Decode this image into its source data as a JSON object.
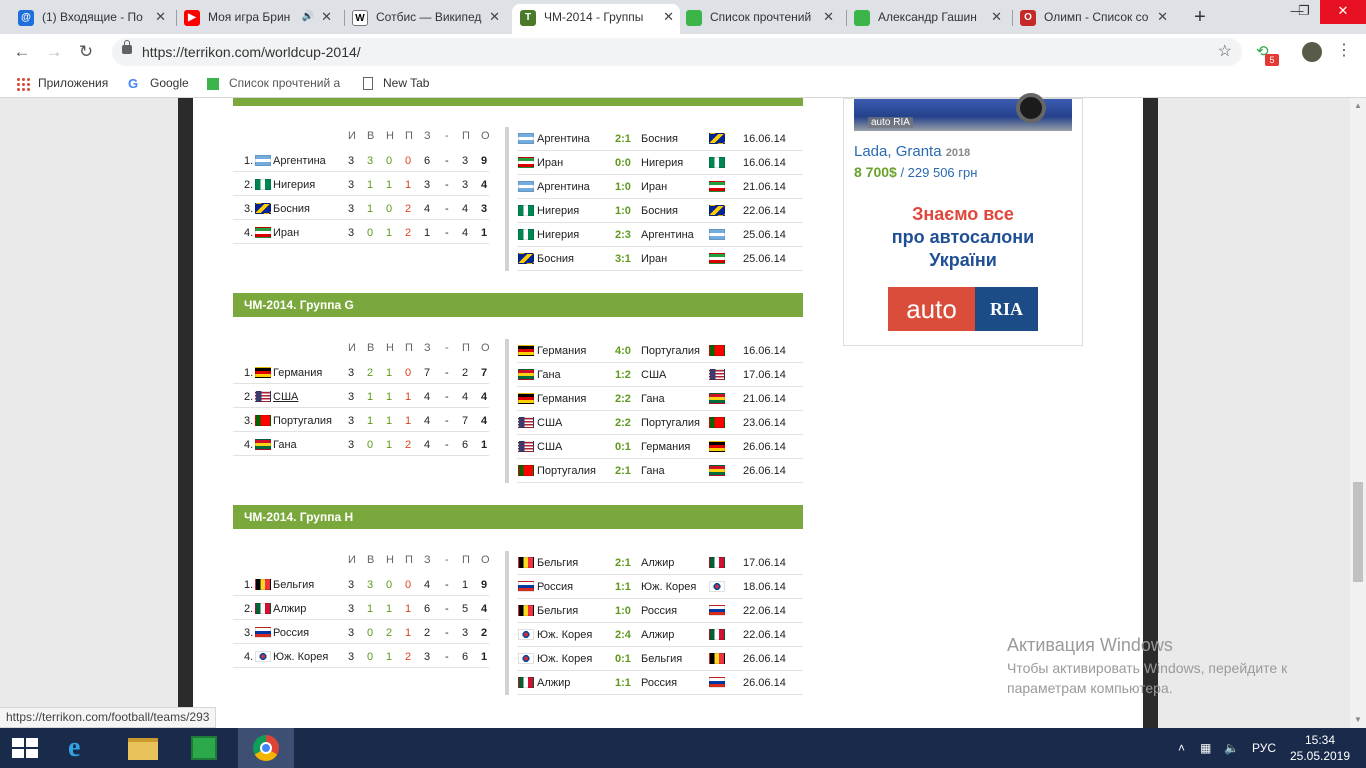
{
  "browser": {
    "tabs": [
      {
        "title": "(1) Входящие - По",
        "icon": "mail-icon",
        "color": "#1e6fd9",
        "glyph": "@"
      },
      {
        "title": "Моя игра Брин",
        "icon": "youtube-icon",
        "color": "#ff0000",
        "glyph": "▶",
        "audio": "🔊"
      },
      {
        "title": "Сотбис — Википед",
        "icon": "wikipedia-icon",
        "color": "#ffffff",
        "glyph": "W"
      },
      {
        "title": "ЧМ-2014 - Группы",
        "icon": "terrikon-icon",
        "color": "#4a7a2a",
        "glyph": "T"
      },
      {
        "title": "Список прочтений",
        "icon": "sheet-icon",
        "color": "#3bb54a",
        "glyph": ""
      },
      {
        "title": "Александр Гашин",
        "icon": "sheet-icon",
        "color": "#3bb54a",
        "glyph": ""
      },
      {
        "title": "Олимп - Список со",
        "icon": "olimp-icon",
        "color": "#c62828",
        "glyph": "O"
      }
    ],
    "new_tab": "+",
    "url": "https://terrikon.com/worldcup-2014/",
    "extension_badge": "5",
    "bookmarks": [
      {
        "label": "Приложения",
        "icon": "apps-grid-icon"
      },
      {
        "label": "Google",
        "icon": "google-icon"
      },
      {
        "label": "Список прочтений а",
        "icon": "sheet-icon"
      },
      {
        "label": "New Tab",
        "icon": "page-icon"
      }
    ],
    "status_link": "https://terrikon.com/football/teams/293"
  },
  "flags": {
    "argentina": [
      "#74acdf",
      "#ffffff",
      "#74acdf",
      "h"
    ],
    "nigeria": [
      "#008751",
      "#ffffff",
      "#008751",
      "v"
    ],
    "bosnia": [
      "#002395",
      "#fecb00",
      "#002395",
      "d"
    ],
    "iran": [
      "#239f40",
      "#ffffff",
      "#da0000",
      "h"
    ],
    "germany": [
      "#000000",
      "#dd0000",
      "#ffce00",
      "h"
    ],
    "usa": [
      "#b22234",
      "#ffffff",
      "#3c3b6e",
      "u"
    ],
    "portugal": [
      "#006600",
      "#ff0000",
      "#ff0000",
      "v"
    ],
    "ghana": [
      "#ce1126",
      "#fcd116",
      "#006b3f",
      "h"
    ],
    "belgium": [
      "#000000",
      "#fdda24",
      "#ef3340",
      "v"
    ],
    "algeria": [
      "#006233",
      "#ffffff",
      "#d21034",
      "v"
    ],
    "russia": [
      "#ffffff",
      "#0039a6",
      "#d52b1e",
      "h"
    ],
    "korea": [
      "#ffffff",
      "#cd2e3a",
      "#0047a0",
      "k"
    ]
  },
  "standings_header": [
    "И",
    "В",
    "Н",
    "П",
    "З",
    "-",
    "П",
    "О"
  ],
  "groups": [
    {
      "title": "",
      "standings": [
        {
          "pos": "1.",
          "team": "Аргентина",
          "flag": "argentina",
          "p": "3",
          "w": "3",
          "d": "0",
          "l": "0",
          "gf": "6",
          "sep": "-",
          "ga": "3",
          "pts": "9"
        },
        {
          "pos": "2.",
          "team": "Нигерия",
          "flag": "nigeria",
          "p": "3",
          "w": "1",
          "d": "1",
          "l": "1",
          "gf": "3",
          "sep": "-",
          "ga": "3",
          "pts": "4"
        },
        {
          "pos": "3.",
          "team": "Босния",
          "flag": "bosnia",
          "p": "3",
          "w": "1",
          "d": "0",
          "l": "2",
          "gf": "4",
          "sep": "-",
          "ga": "4",
          "pts": "3"
        },
        {
          "pos": "4.",
          "team": "Иран",
          "flag": "iran",
          "p": "3",
          "w": "0",
          "d": "1",
          "l": "2",
          "gf": "1",
          "sep": "-",
          "ga": "4",
          "pts": "1"
        }
      ],
      "matches": [
        {
          "home": "Аргентина",
          "hf": "argentina",
          "score": "2:1",
          "away": "Босния",
          "af": "bosnia",
          "date": "16.06.14"
        },
        {
          "home": "Иран",
          "hf": "iran",
          "score": "0:0",
          "away": "Нигерия",
          "af": "nigeria",
          "date": "16.06.14"
        },
        {
          "home": "Аргентина",
          "hf": "argentina",
          "score": "1:0",
          "away": "Иран",
          "af": "iran",
          "date": "21.06.14"
        },
        {
          "home": "Нигерия",
          "hf": "nigeria",
          "score": "1:0",
          "away": "Босния",
          "af": "bosnia",
          "date": "22.06.14"
        },
        {
          "home": "Нигерия",
          "hf": "nigeria",
          "score": "2:3",
          "away": "Аргентина",
          "af": "argentina",
          "date": "25.06.14"
        },
        {
          "home": "Босния",
          "hf": "bosnia",
          "score": "3:1",
          "away": "Иран",
          "af": "iran",
          "date": "25.06.14"
        }
      ]
    },
    {
      "title": "ЧМ-2014. Группа G",
      "standings": [
        {
          "pos": "1.",
          "team": "Германия",
          "flag": "germany",
          "p": "3",
          "w": "2",
          "d": "1",
          "l": "0",
          "gf": "7",
          "sep": "-",
          "ga": "2",
          "pts": "7"
        },
        {
          "pos": "2.",
          "team": "США",
          "flag": "usa",
          "p": "3",
          "w": "1",
          "d": "1",
          "l": "1",
          "gf": "4",
          "sep": "-",
          "ga": "4",
          "pts": "4",
          "link": true
        },
        {
          "pos": "3.",
          "team": "Португалия",
          "flag": "portugal",
          "p": "3",
          "w": "1",
          "d": "1",
          "l": "1",
          "gf": "4",
          "sep": "-",
          "ga": "7",
          "pts": "4"
        },
        {
          "pos": "4.",
          "team": "Гана",
          "flag": "ghana",
          "p": "3",
          "w": "0",
          "d": "1",
          "l": "2",
          "gf": "4",
          "sep": "-",
          "ga": "6",
          "pts": "1"
        }
      ],
      "matches": [
        {
          "home": "Германия",
          "hf": "germany",
          "score": "4:0",
          "away": "Португалия",
          "af": "portugal",
          "date": "16.06.14"
        },
        {
          "home": "Гана",
          "hf": "ghana",
          "score": "1:2",
          "away": "США",
          "af": "usa",
          "date": "17.06.14"
        },
        {
          "home": "Германия",
          "hf": "germany",
          "score": "2:2",
          "away": "Гана",
          "af": "ghana",
          "date": "21.06.14"
        },
        {
          "home": "США",
          "hf": "usa",
          "score": "2:2",
          "away": "Португалия",
          "af": "portugal",
          "date": "23.06.14"
        },
        {
          "home": "США",
          "hf": "usa",
          "score": "0:1",
          "away": "Германия",
          "af": "germany",
          "date": "26.06.14"
        },
        {
          "home": "Португалия",
          "hf": "portugal",
          "score": "2:1",
          "away": "Гана",
          "af": "ghana",
          "date": "26.06.14"
        }
      ]
    },
    {
      "title": "ЧМ-2014. Группа H",
      "standings": [
        {
          "pos": "1.",
          "team": "Бельгия",
          "flag": "belgium",
          "p": "3",
          "w": "3",
          "d": "0",
          "l": "0",
          "gf": "4",
          "sep": "-",
          "ga": "1",
          "pts": "9"
        },
        {
          "pos": "2.",
          "team": "Алжир",
          "flag": "algeria",
          "p": "3",
          "w": "1",
          "d": "1",
          "l": "1",
          "gf": "6",
          "sep": "-",
          "ga": "5",
          "pts": "4"
        },
        {
          "pos": "3.",
          "team": "Россия",
          "flag": "russia",
          "p": "3",
          "w": "0",
          "d": "2",
          "l": "1",
          "gf": "2",
          "sep": "-",
          "ga": "3",
          "pts": "2"
        },
        {
          "pos": "4.",
          "team": "Юж. Корея",
          "flag": "korea",
          "p": "3",
          "w": "0",
          "d": "1",
          "l": "2",
          "gf": "3",
          "sep": "-",
          "ga": "6",
          "pts": "1"
        }
      ],
      "matches": [
        {
          "home": "Бельгия",
          "hf": "belgium",
          "score": "2:1",
          "away": "Алжир",
          "af": "algeria",
          "date": "17.06.14"
        },
        {
          "home": "Россия",
          "hf": "russia",
          "score": "1:1",
          "away": "Юж. Корея",
          "af": "korea",
          "date": "18.06.14"
        },
        {
          "home": "Бельгия",
          "hf": "belgium",
          "score": "1:0",
          "away": "Россия",
          "af": "russia",
          "date": "22.06.14"
        },
        {
          "home": "Юж. Корея",
          "hf": "korea",
          "score": "2:4",
          "away": "Алжир",
          "af": "algeria",
          "date": "22.06.14"
        },
        {
          "home": "Юж. Корея",
          "hf": "korea",
          "score": "0:1",
          "away": "Бельгия",
          "af": "belgium",
          "date": "26.06.14"
        },
        {
          "home": "Алжир",
          "hf": "algeria",
          "score": "1:1",
          "away": "Россия",
          "af": "russia",
          "date": "26.06.14"
        }
      ]
    }
  ],
  "ad": {
    "car_watermark": "auto RIA",
    "car_name": "Lada, Granta",
    "car_year": "2018",
    "price_usd": "8 700$",
    "price_uah": " / 229 506 грн",
    "line1": "Знаємо все",
    "line2": "про автосалони",
    "line3": "України",
    "logo_left": "auto",
    "logo_right": "RIA"
  },
  "watermark": {
    "title": "Активация Windows",
    "line1": "Чтобы активировать Windows, перейдите к",
    "line2": "параметрам компьютера."
  },
  "taskbar": {
    "apps": [
      {
        "name": "start-button",
        "icon": "windows-logo-icon"
      },
      {
        "name": "taskbar-ie",
        "icon": "internet-explorer-icon"
      },
      {
        "name": "taskbar-explorer",
        "icon": "folder-icon"
      },
      {
        "name": "taskbar-store",
        "icon": "store-icon"
      },
      {
        "name": "taskbar-chrome",
        "icon": "chrome-icon"
      }
    ],
    "tray_up": "˄",
    "language": "РУС",
    "time": "15:34",
    "date": "25.05.2019"
  }
}
